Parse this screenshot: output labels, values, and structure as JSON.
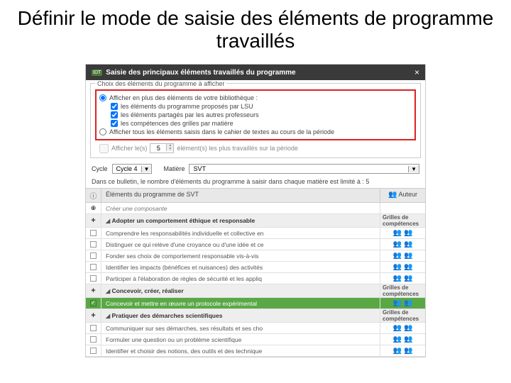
{
  "slide": {
    "title": "Définir le mode de saisie des éléments de programme travaillés"
  },
  "dialog": {
    "badge": "IDT",
    "title": "Saisie des principaux éléments travaillés du programme",
    "close": "×"
  },
  "fieldset": {
    "legend": "Choix des éléments du programme à afficher",
    "opt_biblio": "Afficher en plus des éléments de votre bibliothèque :",
    "chk_lsu": "les éléments du programme proposés par LSU",
    "chk_prof": "les éléments partagés par les autres professeurs",
    "chk_grilles": "les compétences des grilles par matière",
    "opt_cahier": "Afficher tous les éléments saisis dans le cahier de textes au cours de la période",
    "afficher_les": "Afficher le(s)",
    "afficher_count": "5",
    "afficher_tail": "élément(s) les plus travaillés sur la période"
  },
  "filters": {
    "cycle_label": "Cycle",
    "cycle_value": "Cycle 4",
    "matiere_label": "Matière",
    "matiere_value": "SVT"
  },
  "note": "Dans ce bulletin, le nombre d'éléments du programme à saisir dans chaque matière est limité à : 5",
  "table": {
    "head_elements": "Éléments du programme de SVT",
    "head_auteur": "Auteur",
    "create": "Créer une composante",
    "groups": [
      {
        "title": "Adopter un comportement éthique et responsable",
        "right": "Grilles de compétences",
        "rows": [
          "Comprendre les responsabilités individuelle et collective en",
          "Distinguer ce qui relève d'une croyance ou d'une idée et ce",
          "Fonder ses choix de comportement responsable vis-à-vis",
          "Identifier les impacts (bénéfices et nuisances) des activités",
          "Participer à l'élaboration de règles de sécurité et les appliq"
        ]
      },
      {
        "title": "Concevoir, créer, réaliser",
        "right": "Grilles de compétences",
        "rows": [
          "Concevoir et mettre en œuvre un protocole expérimental"
        ],
        "selected": [
          0
        ]
      },
      {
        "title": "Pratiquer des démarches scientifiques",
        "right": "Grilles de compétences",
        "rows": [
          "Communiquer sur ses démarches, ses résultats et ses cho",
          "Formuler une question ou un problème scientifique",
          "Identifier et choisir des notions, des outils et des technique"
        ]
      }
    ]
  }
}
